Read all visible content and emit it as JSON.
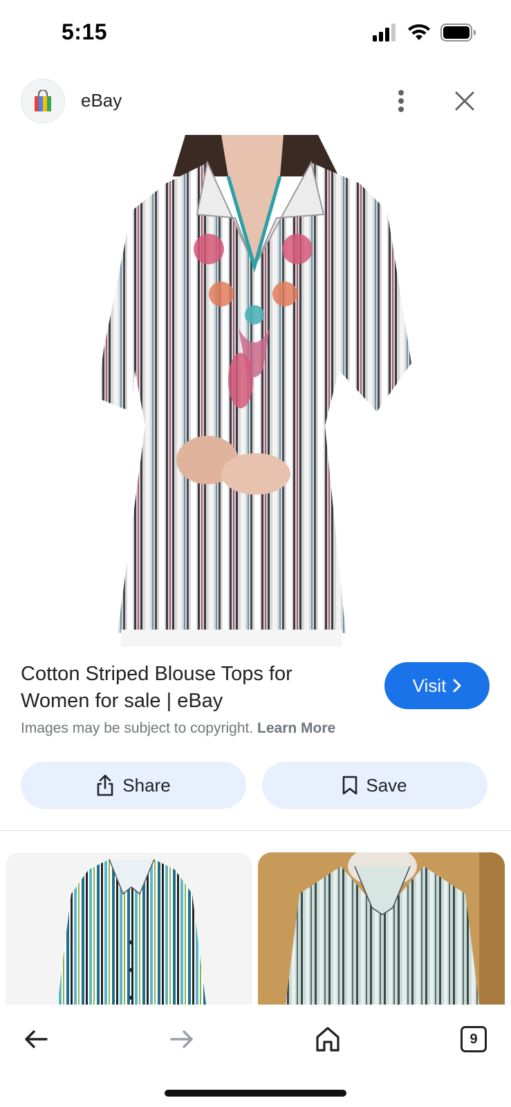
{
  "status_bar": {
    "time": "5:15",
    "icons": [
      "cellular-signal-icon",
      "wifi-icon",
      "battery-icon"
    ]
  },
  "header": {
    "site_name": "eBay",
    "logo_icon": "shopping-bag-icon",
    "more_icon": "more-vert-icon",
    "close_icon": "close-icon"
  },
  "result": {
    "title": "Cotton Striped Blouse Tops for Women for sale | eBay",
    "visit_label": "Visit",
    "copyright_text": "Images may be subject to copyright.",
    "learn_more_label": "Learn More",
    "share_label": "Share",
    "save_label": "Save"
  },
  "bottom_nav": {
    "tab_count": "9",
    "icons": [
      "arrow-back-icon",
      "arrow-forward-icon",
      "home-icon",
      "tabs-icon"
    ]
  },
  "colors": {
    "accent": "#1a73e8",
    "chip_bg": "#e8f0fe",
    "muted_text": "#70757a"
  }
}
